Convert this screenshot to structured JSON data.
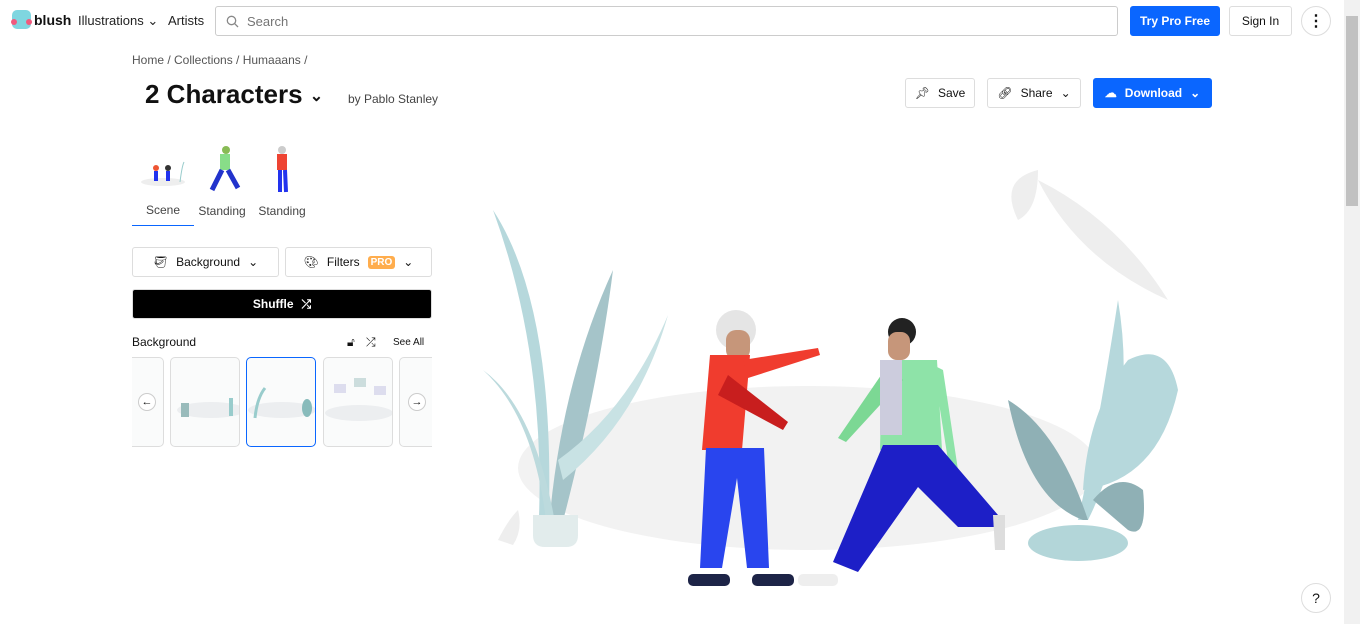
{
  "nav": {
    "brand": "blush",
    "illustrations": "Illustrations",
    "artists": "Artists",
    "search_placeholder": "Search",
    "try_pro": "Try Pro Free",
    "sign_in": "Sign In"
  },
  "breadcrumb": "Home / Collections / Humaaans /",
  "title": "2 Characters",
  "author": "by Pablo Stanley",
  "actions": {
    "save": "Save",
    "share": "Share",
    "download": "Download"
  },
  "tabs": [
    {
      "label": "Scene",
      "active": true
    },
    {
      "label": "Standing"
    },
    {
      "label": "Standing"
    }
  ],
  "controls": {
    "background": "Background",
    "filters": "Filters",
    "pro_badge": "PRO",
    "shuffle": "Shuffle"
  },
  "background_section": {
    "title": "Background",
    "see_all": "See All",
    "selected_index": 2
  },
  "help": "?",
  "colors": {
    "accent": "#0a66ff",
    "pro": "#ffad4d"
  }
}
